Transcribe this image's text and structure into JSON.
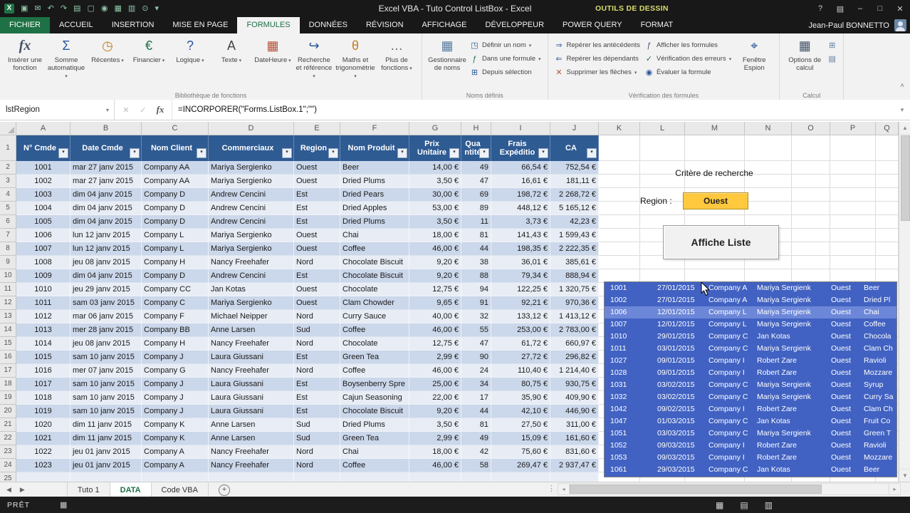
{
  "window": {
    "title": "Excel VBA - Tuto Control ListBox - Excel",
    "contextual_group": "OUTILS DE DESSIN",
    "controls": {
      "help": "?",
      "ribbon_options": "▤",
      "minimize": "–",
      "restore": "□",
      "close": "✕"
    },
    "qat": [
      {
        "name": "excel-logo",
        "glyph": "X"
      },
      {
        "name": "save",
        "glyph": "▣"
      },
      {
        "name": "email",
        "glyph": "✉"
      },
      {
        "name": "undo",
        "glyph": "↶"
      },
      {
        "name": "redo",
        "glyph": "↷"
      },
      {
        "name": "print",
        "glyph": "▤"
      },
      {
        "name": "new-document",
        "glyph": "▢"
      },
      {
        "name": "camera",
        "glyph": "◉"
      },
      {
        "name": "table",
        "glyph": "▦"
      },
      {
        "name": "sheet",
        "glyph": "▥"
      },
      {
        "name": "search",
        "glyph": "⊙"
      },
      {
        "name": "qat-customize",
        "glyph": "▾"
      }
    ]
  },
  "ribbon": {
    "active_tab": "FORMULES",
    "tabs": [
      "FICHIER",
      "ACCUEIL",
      "INSERTION",
      "MISE EN PAGE",
      "FORMULES",
      "DONNÉES",
      "RÉVISION",
      "AFFICHAGE",
      "DÉVELOPPEUR",
      "POWER QUERY",
      "FORMAT"
    ],
    "user_name": "Jean-Paul BONNETTO",
    "collapse_glyph": "˄",
    "function_library": {
      "label": "Bibliothèque de fonctions",
      "insert_function": {
        "label": "Insérer une fonction",
        "glyph": "fx"
      },
      "items": [
        {
          "label": "Somme automatique",
          "glyph": "Σ",
          "color": "#2b579a",
          "arrow": true
        },
        {
          "label": "Récentes",
          "glyph": "◷",
          "color": "#c07f28",
          "arrow": true
        },
        {
          "label": "Financier",
          "glyph": "€",
          "color": "#1e7145",
          "arrow": true
        },
        {
          "label": "Logique",
          "glyph": "?",
          "color": "#2b579a",
          "arrow": true
        },
        {
          "label": "Texte",
          "glyph": "A",
          "color": "#444444",
          "arrow": true
        },
        {
          "label": "DateHeure",
          "glyph": "▦",
          "color": "#b4533c",
          "arrow": true
        },
        {
          "label": "Recherche et référence",
          "glyph": "↪",
          "color": "#2b579a",
          "arrow": true
        },
        {
          "label": "Maths et trigonométrie",
          "glyph": "θ",
          "color": "#c07f28",
          "arrow": true
        },
        {
          "label": "Plus de fonctions",
          "glyph": "…",
          "color": "#666666",
          "arrow": true
        }
      ]
    },
    "defined_names": {
      "label": "Noms définis",
      "name_manager": {
        "label": "Gestionnaire de noms",
        "glyph": "▦"
      },
      "items": [
        {
          "label": "Définir un nom",
          "glyph": "◳",
          "color": "#2b579a",
          "arrow": true
        },
        {
          "label": "Dans une formule",
          "glyph": "ƒ",
          "color": "#1e7145",
          "arrow": true
        },
        {
          "label": "Depuis sélection",
          "glyph": "⊞",
          "color": "#2b579a",
          "arrow": false
        }
      ]
    },
    "auditing": {
      "label": "Vérification des formules",
      "col1": [
        {
          "label": "Repérer les antécédents",
          "glyph": "⇒",
          "color": "#2b579a",
          "arrow": false
        },
        {
          "label": "Repérer les dépendants",
          "glyph": "⇐",
          "color": "#2b579a",
          "arrow": false
        },
        {
          "label": "Supprimer les flèches",
          "glyph": "✕",
          "color": "#b4533c",
          "arrow": true
        }
      ],
      "col2": [
        {
          "label": "Afficher les formules",
          "glyph": "ƒ",
          "color": "#44546a",
          "arrow": false
        },
        {
          "label": "Vérification des erreurs",
          "glyph": "✓",
          "color": "#1e7145",
          "arrow": true
        },
        {
          "label": "Évaluer la formule",
          "glyph": "◉",
          "color": "#2b579a",
          "arrow": false
        }
      ],
      "watch_window": {
        "label": "Fenêtre Espion",
        "glyph": "⌖"
      }
    },
    "calculation": {
      "label": "Calcul",
      "calc_options": {
        "label": "Options de calcul",
        "glyph": "▦"
      },
      "extra": [
        {
          "name": "calculate-now",
          "glyph": "⊞"
        },
        {
          "name": "calculate-sheet",
          "glyph": "▤"
        }
      ]
    }
  },
  "formula_bar": {
    "name_box": "lstRegion",
    "name_arrow": "▾",
    "cancel": "✕",
    "enter": "✓",
    "fx": "fx",
    "formula": "=INCORPORER(\"Forms.ListBox.1\";\"\")",
    "expand": "▾"
  },
  "grid": {
    "columns": [
      "A",
      "B",
      "C",
      "D",
      "E",
      "F",
      "G",
      "H",
      "I",
      "J",
      "K",
      "L",
      "M",
      "N",
      "O",
      "P",
      "Q"
    ],
    "table": {
      "headers": [
        "N° Cmde",
        "Date Cmde",
        "Nom Client",
        "Commerciaux",
        "Region",
        "Nom Produit",
        "Prix Unitaire",
        "Quantité",
        "Frais Expéditio",
        "CA"
      ],
      "rows": [
        [
          "1001",
          "mar 27 janv 2015",
          "Company AA",
          "Mariya Sergienko",
          "Ouest",
          "Beer",
          "14,00 €",
          "49",
          "66,54 €",
          "752,54 €"
        ],
        [
          "1002",
          "mar 27 janv 2015",
          "Company AA",
          "Mariya Sergienko",
          "Ouest",
          "Dried Plums",
          "3,50 €",
          "47",
          "16,61 €",
          "181,11 €"
        ],
        [
          "1003",
          "dim 04 janv 2015",
          "Company D",
          "Andrew Cencini",
          "Est",
          "Dried Pears",
          "30,00 €",
          "69",
          "198,72 €",
          "2 268,72 €"
        ],
        [
          "1004",
          "dim 04 janv 2015",
          "Company D",
          "Andrew Cencini",
          "Est",
          "Dried Apples",
          "53,00 €",
          "89",
          "448,12 €",
          "5 165,12 €"
        ],
        [
          "1005",
          "dim 04 janv 2015",
          "Company D",
          "Andrew Cencini",
          "Est",
          "Dried Plums",
          "3,50 €",
          "11",
          "3,73 €",
          "42,23 €"
        ],
        [
          "1006",
          "lun 12 janv 2015",
          "Company L",
          "Mariya Sergienko",
          "Ouest",
          "Chai",
          "18,00 €",
          "81",
          "141,43 €",
          "1 599,43 €"
        ],
        [
          "1007",
          "lun 12 janv 2015",
          "Company L",
          "Mariya Sergienko",
          "Ouest",
          "Coffee",
          "46,00 €",
          "44",
          "198,35 €",
          "2 222,35 €"
        ],
        [
          "1008",
          "jeu 08 janv 2015",
          "Company H",
          "Nancy Freehafer",
          "Nord",
          "Chocolate Biscuit",
          "9,20 €",
          "38",
          "36,01 €",
          "385,61 €"
        ],
        [
          "1009",
          "dim 04 janv 2015",
          "Company D",
          "Andrew Cencini",
          "Est",
          "Chocolate Biscuit",
          "9,20 €",
          "88",
          "79,34 €",
          "888,94 €"
        ],
        [
          "1010",
          "jeu 29 janv 2015",
          "Company CC",
          "Jan Kotas",
          "Ouest",
          "Chocolate",
          "12,75 €",
          "94",
          "122,25 €",
          "1 320,75 €"
        ],
        [
          "1011",
          "sam 03 janv 2015",
          "Company C",
          "Mariya Sergienko",
          "Ouest",
          "Clam Chowder",
          "9,65 €",
          "91",
          "92,21 €",
          "970,36 €"
        ],
        [
          "1012",
          "mar 06 janv 2015",
          "Company F",
          "Michael Neipper",
          "Nord",
          "Curry Sauce",
          "40,00 €",
          "32",
          "133,12 €",
          "1 413,12 €"
        ],
        [
          "1013",
          "mer 28 janv 2015",
          "Company BB",
          "Anne Larsen",
          "Sud",
          "Coffee",
          "46,00 €",
          "55",
          "253,00 €",
          "2 783,00 €"
        ],
        [
          "1014",
          "jeu 08 janv 2015",
          "Company H",
          "Nancy Freehafer",
          "Nord",
          "Chocolate",
          "12,75 €",
          "47",
          "61,72 €",
          "660,97 €"
        ],
        [
          "1015",
          "sam 10 janv 2015",
          "Company J",
          "Laura Giussani",
          "Est",
          "Green Tea",
          "2,99 €",
          "90",
          "27,72 €",
          "296,82 €"
        ],
        [
          "1016",
          "mer 07 janv 2015",
          "Company G",
          "Nancy Freehafer",
          "Nord",
          "Coffee",
          "46,00 €",
          "24",
          "110,40 €",
          "1 214,40 €"
        ],
        [
          "1017",
          "sam 10 janv 2015",
          "Company J",
          "Laura Giussani",
          "Est",
          "Boysenberry Spre",
          "25,00 €",
          "34",
          "80,75 €",
          "930,75 €"
        ],
        [
          "1018",
          "sam 10 janv 2015",
          "Company J",
          "Laura Giussani",
          "Est",
          "Cajun Seasoning",
          "22,00 €",
          "17",
          "35,90 €",
          "409,90 €"
        ],
        [
          "1019",
          "sam 10 janv 2015",
          "Company J",
          "Laura Giussani",
          "Est",
          "Chocolate Biscuit",
          "9,20 €",
          "44",
          "42,10 €",
          "446,90 €"
        ],
        [
          "1020",
          "dim 11 janv 2015",
          "Company K",
          "Anne Larsen",
          "Sud",
          "Dried Plums",
          "3,50 €",
          "81",
          "27,50 €",
          "311,00 €"
        ],
        [
          "1021",
          "dim 11 janv 2015",
          "Company K",
          "Anne Larsen",
          "Sud",
          "Green Tea",
          "2,99 €",
          "49",
          "15,09 €",
          "161,60 €"
        ],
        [
          "1022",
          "jeu 01 janv 2015",
          "Company A",
          "Nancy Freehafer",
          "Nord",
          "Chai",
          "18,00 €",
          "42",
          "75,60 €",
          "831,60 €"
        ],
        [
          "1023",
          "jeu 01 janv 2015",
          "Company A",
          "Nancy Freehafer",
          "Nord",
          "Coffee",
          "46,00 €",
          "58",
          "269,47 €",
          "2 937,47 €"
        ]
      ]
    }
  },
  "search_panel": {
    "title": "Critère de recherche",
    "region_label": "Region :",
    "region_value": "Ouest",
    "button_label": "Affiche Liste"
  },
  "listbox": {
    "focus_index": 2,
    "rows": [
      [
        "1001",
        "27/01/2015",
        "Company A",
        "Mariya Sergienk",
        "Ouest",
        "Beer"
      ],
      [
        "1002",
        "27/01/2015",
        "Company A",
        "Mariya Sergienk",
        "Ouest",
        "Dried Pl"
      ],
      [
        "1006",
        "12/01/2015",
        "Company L",
        "Mariya Sergienk",
        "Ouest",
        "Chai"
      ],
      [
        "1007",
        "12/01/2015",
        "Company L",
        "Mariya Sergienk",
        "Ouest",
        "Coffee"
      ],
      [
        "1010",
        "29/01/2015",
        "Company C",
        "Jan Kotas",
        "Ouest",
        "Chocola"
      ],
      [
        "1011",
        "03/01/2015",
        "Company C",
        "Mariya Sergienk",
        "Ouest",
        "Clam Ch"
      ],
      [
        "1027",
        "09/01/2015",
        "Company I",
        "Robert Zare",
        "Ouest",
        "Ravioli"
      ],
      [
        "1028",
        "09/01/2015",
        "Company I",
        "Robert Zare",
        "Ouest",
        "Mozzare"
      ],
      [
        "1031",
        "03/02/2015",
        "Company C",
        "Mariya Sergienk",
        "Ouest",
        "Syrup"
      ],
      [
        "1032",
        "03/02/2015",
        "Company C",
        "Mariya Sergienk",
        "Ouest",
        "Curry Sa"
      ],
      [
        "1042",
        "09/02/2015",
        "Company I",
        "Robert Zare",
        "Ouest",
        "Clam Ch"
      ],
      [
        "1047",
        "01/03/2015",
        "Company C",
        "Jan Kotas",
        "Ouest",
        "Fruit Co"
      ],
      [
        "1051",
        "03/03/2015",
        "Company C",
        "Mariya Sergienk",
        "Ouest",
        "Green T"
      ],
      [
        "1052",
        "09/03/2015",
        "Company I",
        "Robert Zare",
        "Ouest",
        "Ravioli"
      ],
      [
        "1053",
        "09/03/2015",
        "Company I",
        "Robert Zare",
        "Ouest",
        "Mozzare"
      ],
      [
        "1061",
        "29/03/2015",
        "Company C",
        "Jan Kotas",
        "Ouest",
        "Beer"
      ]
    ]
  },
  "sheet_tabs": {
    "tabs": [
      "Tuto 1",
      "DATA",
      "Code VBA"
    ],
    "active": "DATA",
    "nav_left": "◀",
    "nav_right": "▶",
    "add_glyph": "+",
    "splitter": "⋮"
  },
  "scrollbars": {
    "up": "▲",
    "down": "▼",
    "left": "◂",
    "right": "▸"
  },
  "status_bar": {
    "mode": "PRÊT",
    "macro_icon": "▦",
    "view_icons": [
      {
        "name": "view-normal",
        "glyph": "▦"
      },
      {
        "name": "view-page-layout",
        "glyph": "▤"
      },
      {
        "name": "view-page-break",
        "glyph": "▥"
      }
    ]
  }
}
